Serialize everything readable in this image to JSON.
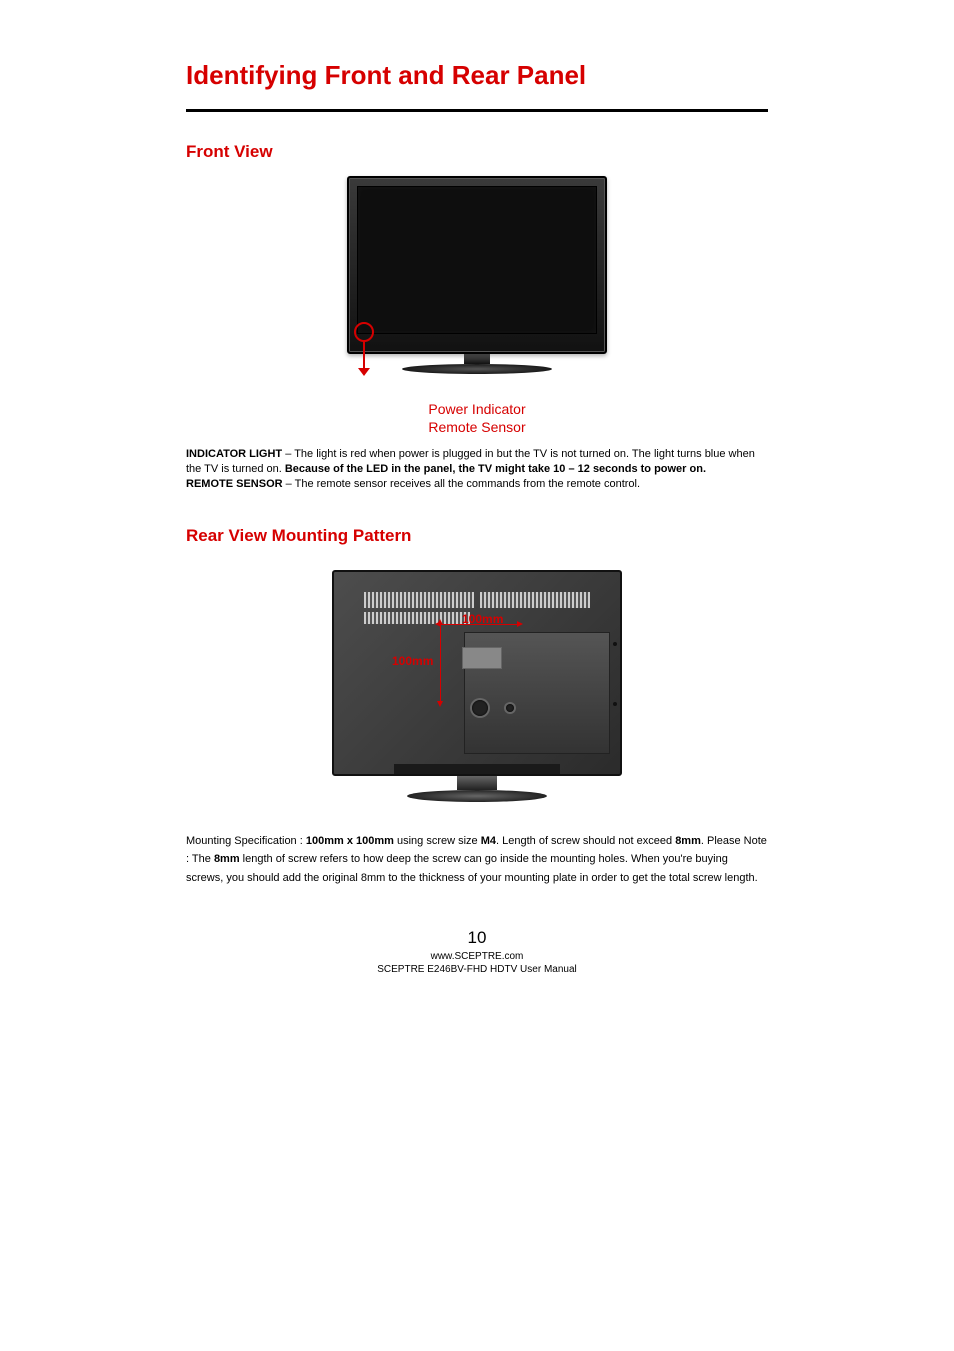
{
  "title": "Identifying Front and Rear Panel",
  "sections": {
    "front": {
      "title": "Front View",
      "callout": {
        "line1": "Power Indicator",
        "line2": "Remote Sensor"
      },
      "indicator": {
        "label": "INDICATOR LIGHT",
        "text1": " – The light is red when power is plugged in but the TV is not turned on.  The light turns blue when the TV is turned on. ",
        "bold1": "Because of the LED in the panel, the TV might take 10 – 12 seconds to power on."
      },
      "remote": {
        "label": "REMOTE SENSOR",
        "text": " – The remote sensor receives all the commands from the remote control."
      }
    },
    "rear": {
      "title": "Rear View Mounting Pattern",
      "dim_h": "100mm",
      "dim_v": "100mm",
      "spec": {
        "pre": "Mounting Specification : ",
        "b1": "100mm x 100mm",
        "mid1": " using screw size ",
        "b2": "M4",
        "mid2": ". Length of screw should not exceed ",
        "b3": "8mm",
        "mid3": ".   Please Note : The ",
        "b4": "8mm",
        "post": " length of screw refers to how deep the screw can go inside the mounting holes.  When you're buying screws, you should add the original 8mm to the thickness of your mounting plate in order to get the total screw length."
      }
    }
  },
  "footer": {
    "page": "10",
    "url": "www.SCEPTRE.com",
    "product": "SCEPTRE E246BV-FHD HDTV User Manual"
  }
}
